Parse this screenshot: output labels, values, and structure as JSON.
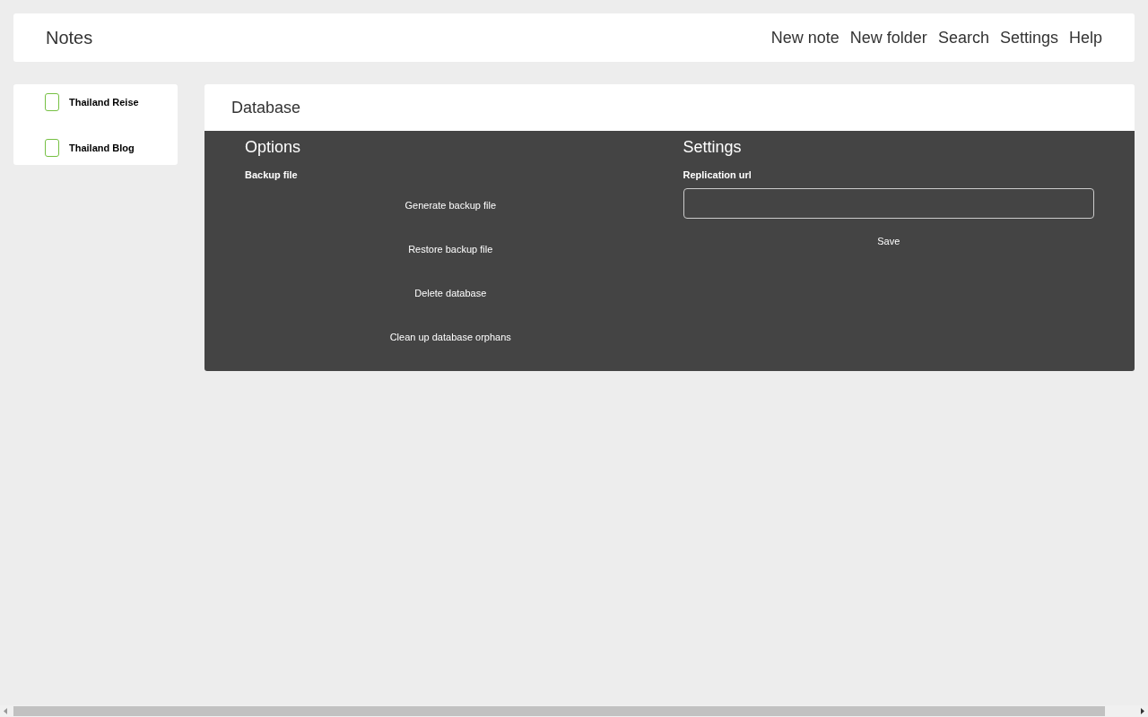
{
  "app": {
    "title": "Notes"
  },
  "nav": [
    "New note",
    "New folder",
    "Search",
    "Settings",
    "Help"
  ],
  "sidebar": {
    "items": [
      {
        "label": "Thailand Reise"
      },
      {
        "label": "Thailand Blog"
      }
    ]
  },
  "page": {
    "title": "Database",
    "options": {
      "heading": "Options",
      "section": "Backup file",
      "buttons": [
        "Generate backup file",
        "Restore backup file",
        "Delete database",
        "Clean up database orphans"
      ]
    },
    "settings": {
      "heading": "Settings",
      "field_label": "Replication url",
      "button": "Save"
    }
  }
}
